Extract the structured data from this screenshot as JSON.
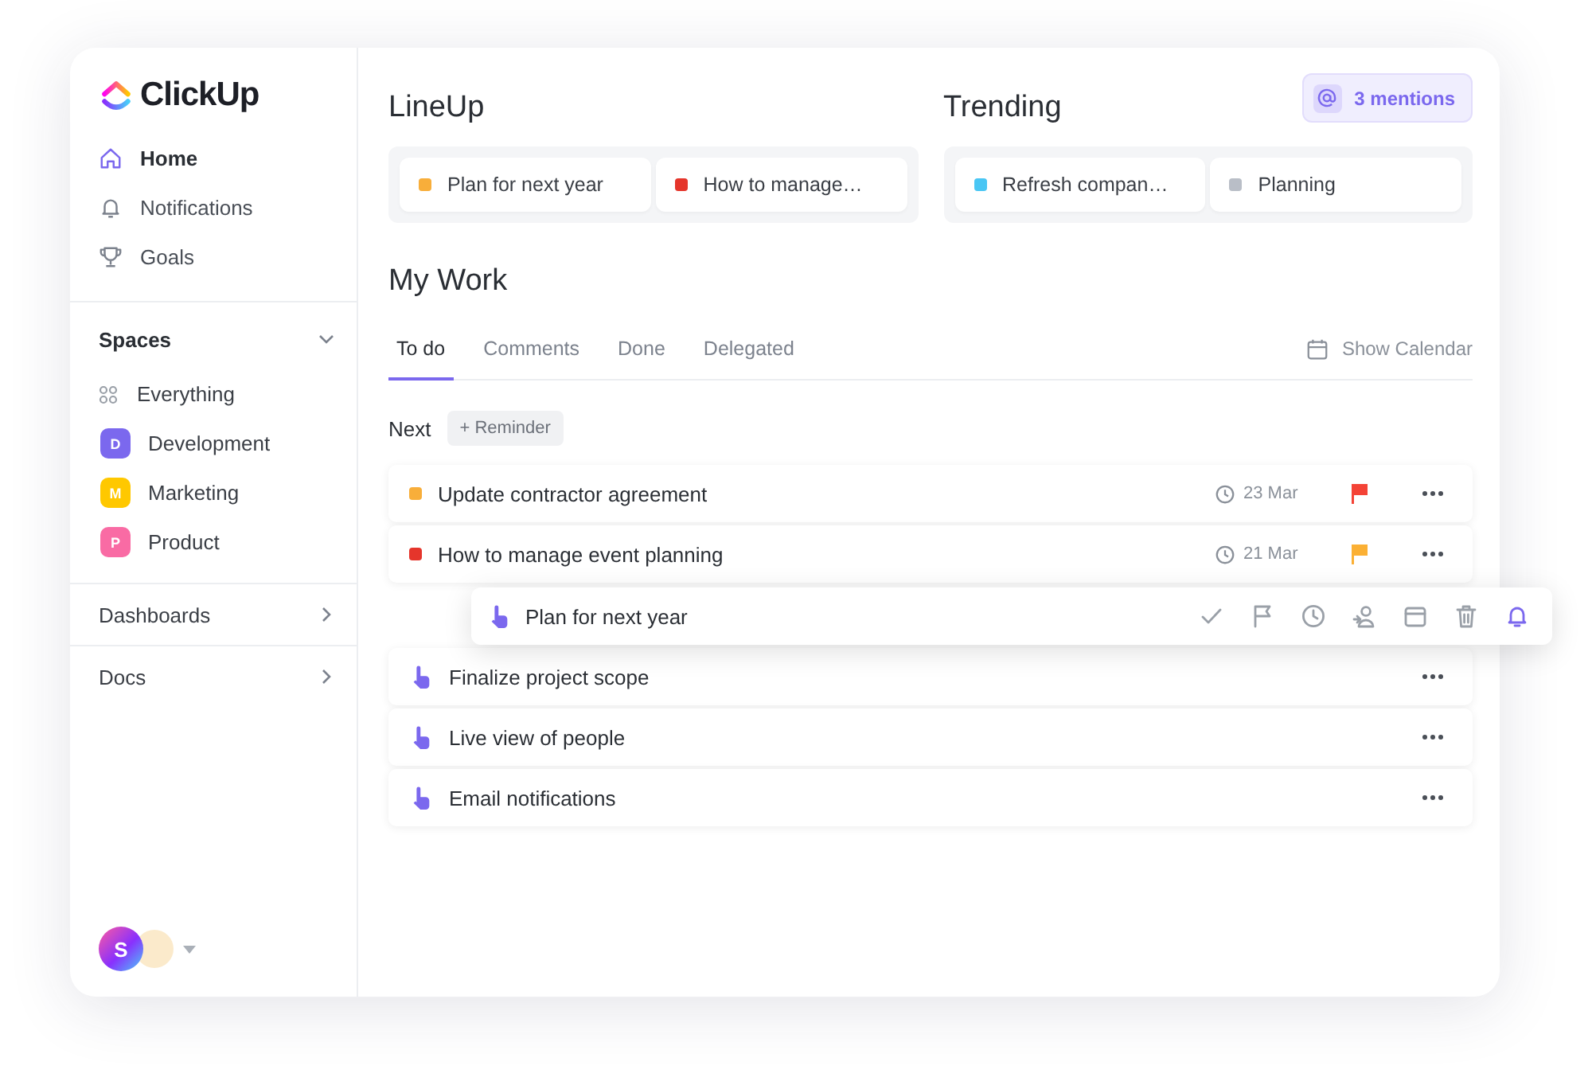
{
  "logo": {
    "text": "ClickUp"
  },
  "nav": [
    {
      "label": "Home",
      "selected": true,
      "kind": "home"
    },
    {
      "label": "Notifications",
      "selected": false,
      "kind": "bell"
    },
    {
      "label": "Goals",
      "selected": false,
      "kind": "trophy"
    }
  ],
  "spaces": {
    "title": "Spaces",
    "expanded": true,
    "items": [
      {
        "kind": "all",
        "label": "Everything"
      },
      {
        "kind": "space",
        "letter": "D",
        "label": "Development",
        "color": "#7b68ee"
      },
      {
        "kind": "space",
        "letter": "M",
        "label": "Marketing",
        "color": "#ffc800"
      },
      {
        "kind": "space",
        "letter": "P",
        "label": "Product",
        "color": "#f96ba4"
      }
    ]
  },
  "sections": [
    {
      "label": "Dashboards",
      "expanded": false
    },
    {
      "label": "Docs",
      "expanded": false
    }
  ],
  "user": {
    "initial": "S"
  },
  "lineup": {
    "title": "LineUp",
    "items": [
      {
        "label": "Plan for next year",
        "color": "#f8ae3a"
      },
      {
        "label": "How to manage…",
        "color": "#e5352b"
      }
    ]
  },
  "trending": {
    "title": "Trending",
    "items": [
      {
        "label": "Refresh compan…",
        "color": "#49c6f4"
      },
      {
        "label": "Planning",
        "color": "#b9bec7"
      }
    ]
  },
  "mentions": {
    "label": "3 mentions"
  },
  "my_work": {
    "title": "My Work",
    "tabs": [
      {
        "label": "To do",
        "selected": true
      },
      {
        "label": "Comments",
        "selected": false
      },
      {
        "label": "Done",
        "selected": false
      },
      {
        "label": "Delegated",
        "selected": false
      }
    ],
    "show_calendar": "Show Calendar",
    "group": "Next",
    "reminder": "+ Reminder",
    "tasks": [
      {
        "kind": "status",
        "label": "Update contractor agreement",
        "color": "#f8ae3a",
        "date": "23 Mar",
        "flag": {
          "color": "#f44336"
        }
      },
      {
        "kind": "status",
        "label": "How to manage event planning",
        "color": "#e5352b",
        "date": "21 Mar",
        "flag": {
          "color": "#fbb034"
        }
      },
      {
        "kind": "placeholder"
      },
      {
        "kind": "drag",
        "label": "Finalize project scope"
      },
      {
        "kind": "drag",
        "label": "Live view of people"
      },
      {
        "kind": "drag",
        "label": "Email notifications"
      }
    ]
  },
  "drag_card": {
    "label": "Plan for next year",
    "actions": [
      {
        "kind": "check",
        "selected": false
      },
      {
        "kind": "flag",
        "selected": false
      },
      {
        "kind": "clock",
        "selected": false
      },
      {
        "kind": "assign",
        "selected": false
      },
      {
        "kind": "calendar",
        "selected": false
      },
      {
        "kind": "trash",
        "selected": false
      },
      {
        "kind": "bell",
        "selected": true
      }
    ]
  }
}
